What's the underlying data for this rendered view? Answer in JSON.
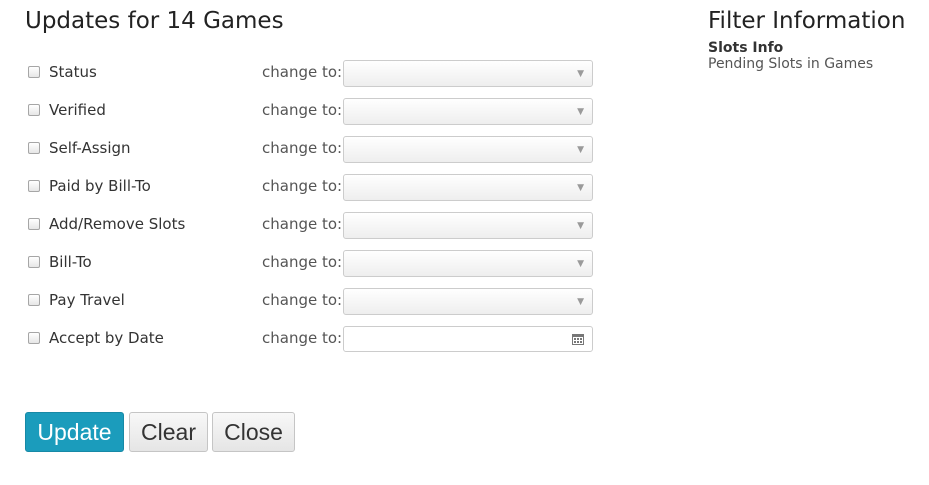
{
  "header": {
    "title": "Updates for 14 Games"
  },
  "filter_info": {
    "title": "Filter Information",
    "subtitle": "Slots Info",
    "text": "Pending Slots in Games"
  },
  "fields": [
    {
      "label": "Status",
      "change_label": "change to:",
      "type": "select",
      "value": "",
      "checked": false
    },
    {
      "label": "Verified",
      "change_label": "change to:",
      "type": "select",
      "value": "",
      "checked": false
    },
    {
      "label": "Self-Assign",
      "change_label": "change to:",
      "type": "select",
      "value": "",
      "checked": false
    },
    {
      "label": "Paid by Bill-To",
      "change_label": "change to:",
      "type": "select",
      "value": "",
      "checked": false
    },
    {
      "label": "Add/Remove Slots",
      "change_label": "change to:",
      "type": "select",
      "value": "",
      "checked": false
    },
    {
      "label": "Bill-To",
      "change_label": "change to:",
      "type": "select",
      "value": "",
      "checked": false
    },
    {
      "label": "Pay Travel",
      "change_label": "change to:",
      "type": "select",
      "value": "",
      "checked": false
    },
    {
      "label": "Accept by Date",
      "change_label": "change to:",
      "type": "date",
      "value": "",
      "checked": false
    }
  ],
  "icons": {
    "dropdown": "chevron-down-icon",
    "date": "calendar-icon"
  },
  "buttons": {
    "update": "Update",
    "clear": "Clear",
    "close": "Close"
  },
  "colors": {
    "primary": "#1b9cbc",
    "title_text": "#222222"
  }
}
